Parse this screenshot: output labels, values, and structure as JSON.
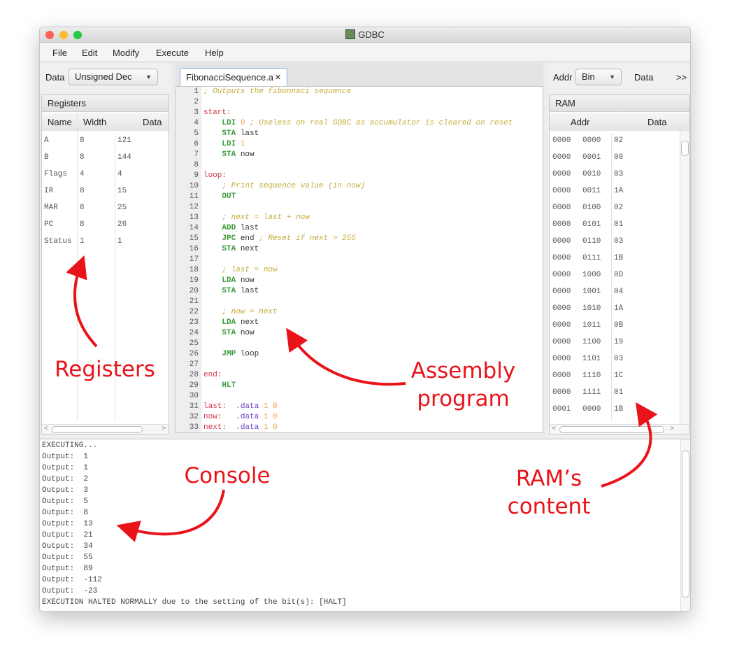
{
  "window": {
    "title": "GDBC",
    "controls": {
      "close": "#fc5f57",
      "minimize": "#fdbc2e",
      "maximize": "#28c840"
    }
  },
  "menu": [
    "File",
    "Edit",
    "Modify",
    "Execute",
    "Help"
  ],
  "left": {
    "data_label": "Data",
    "data_format": "Unsigned Dec",
    "panel_title": "Registers",
    "columns": [
      "Name",
      "Width",
      "Data"
    ],
    "rows": [
      [
        "A",
        "8",
        "121"
      ],
      [
        "B",
        "8",
        "144"
      ],
      [
        "Flags",
        "4",
        "4"
      ],
      [
        "IR",
        "8",
        "15"
      ],
      [
        "MAR",
        "8",
        "25"
      ],
      [
        "PC",
        "8",
        "26"
      ],
      [
        "Status",
        "1",
        "1"
      ]
    ]
  },
  "editor": {
    "tab_label": "FibonacciSequence.a",
    "close_icon": "×",
    "lines": [
      [
        [
          "c",
          "; Outputs the fibonnaci sequence"
        ]
      ],
      [],
      [
        [
          "l",
          "start:"
        ]
      ],
      [
        [
          "t",
          "    "
        ],
        [
          "k",
          "LDI"
        ],
        [
          "t",
          " "
        ],
        [
          "n",
          "0"
        ],
        [
          "c",
          " ; Useless on real GDBC as accumulator is cleared on reset"
        ]
      ],
      [
        [
          "t",
          "    "
        ],
        [
          "k",
          "STA"
        ],
        [
          "t",
          " last"
        ]
      ],
      [
        [
          "t",
          "    "
        ],
        [
          "k",
          "LDI"
        ],
        [
          "t",
          " "
        ],
        [
          "n",
          "1"
        ]
      ],
      [
        [
          "t",
          "    "
        ],
        [
          "k",
          "STA"
        ],
        [
          "t",
          " now"
        ]
      ],
      [],
      [
        [
          "l",
          "loop:"
        ]
      ],
      [
        [
          "t",
          "    "
        ],
        [
          "c",
          "; Print sequence value (in now)"
        ]
      ],
      [
        [
          "t",
          "    "
        ],
        [
          "k",
          "OUT"
        ]
      ],
      [],
      [
        [
          "t",
          "    "
        ],
        [
          "c",
          "; next = last + now"
        ]
      ],
      [
        [
          "t",
          "    "
        ],
        [
          "k",
          "ADD"
        ],
        [
          "t",
          " last"
        ]
      ],
      [
        [
          "t",
          "    "
        ],
        [
          "k",
          "JPC"
        ],
        [
          "t",
          " end "
        ],
        [
          "c",
          "; Reset if next > 255"
        ]
      ],
      [
        [
          "t",
          "    "
        ],
        [
          "k",
          "STA"
        ],
        [
          "t",
          " next"
        ]
      ],
      [],
      [
        [
          "t",
          "    "
        ],
        [
          "c",
          "; last = now"
        ]
      ],
      [
        [
          "t",
          "    "
        ],
        [
          "k",
          "LDA"
        ],
        [
          "t",
          " now"
        ]
      ],
      [
        [
          "t",
          "    "
        ],
        [
          "k",
          "STA"
        ],
        [
          "t",
          " last"
        ]
      ],
      [],
      [
        [
          "t",
          "    "
        ],
        [
          "c",
          "; now = next"
        ]
      ],
      [
        [
          "t",
          "    "
        ],
        [
          "k",
          "LDA"
        ],
        [
          "t",
          " next"
        ]
      ],
      [
        [
          "t",
          "    "
        ],
        [
          "k",
          "STA"
        ],
        [
          "t",
          " now"
        ]
      ],
      [],
      [
        [
          "t",
          "    "
        ],
        [
          "k",
          "JMP"
        ],
        [
          "t",
          " loop"
        ]
      ],
      [],
      [
        [
          "l",
          "end:"
        ]
      ],
      [
        [
          "t",
          "    "
        ],
        [
          "k",
          "HLT"
        ]
      ],
      [],
      [
        [
          "l",
          "last:"
        ],
        [
          "t",
          "  "
        ],
        [
          "d",
          ".data"
        ],
        [
          "t",
          " "
        ],
        [
          "n",
          "1 0"
        ]
      ],
      [
        [
          "l",
          "now:"
        ],
        [
          "t",
          "   "
        ],
        [
          "d",
          ".data"
        ],
        [
          "t",
          " "
        ],
        [
          "n",
          "1 0"
        ]
      ],
      [
        [
          "l",
          "next:"
        ],
        [
          "t",
          "  "
        ],
        [
          "d",
          ".data"
        ],
        [
          "t",
          " "
        ],
        [
          "n",
          "1 0"
        ]
      ]
    ]
  },
  "right": {
    "addr_label": "Addr",
    "addr_format": "Bin",
    "data_label": "Data",
    "more_label": ">>",
    "panel_title": "RAM",
    "columns": [
      "Addr",
      "Data"
    ],
    "rows": [
      [
        "0000",
        "0000",
        "02"
      ],
      [
        "0000",
        "0001",
        "00"
      ],
      [
        "0000",
        "0010",
        "03"
      ],
      [
        "0000",
        "0011",
        "1A"
      ],
      [
        "0000",
        "0100",
        "02"
      ],
      [
        "0000",
        "0101",
        "01"
      ],
      [
        "0000",
        "0110",
        "03"
      ],
      [
        "0000",
        "0111",
        "1B"
      ],
      [
        "0000",
        "1000",
        "0D"
      ],
      [
        "0000",
        "1001",
        "04"
      ],
      [
        "0000",
        "1010",
        "1A"
      ],
      [
        "0000",
        "1011",
        "0B"
      ],
      [
        "0000",
        "1100",
        "19"
      ],
      [
        "0000",
        "1101",
        "03"
      ],
      [
        "0000",
        "1110",
        "1C"
      ],
      [
        "0000",
        "1111",
        "01"
      ],
      [
        "0001",
        "0000",
        "1B"
      ]
    ]
  },
  "console": {
    "lines": [
      "EXECUTING...",
      "Output:  1",
      "Output:  1",
      "Output:  2",
      "Output:  3",
      "Output:  5",
      "Output:  8",
      "Output:  13",
      "Output:  21",
      "Output:  34",
      "Output:  55",
      "Output:  89",
      "Output:  -112",
      "Output:  -23",
      "EXECUTION HALTED NORMALLY due to the setting of the bit(s): [HALT]"
    ]
  },
  "annotations": {
    "registers": "Registers",
    "assembly": "Assembly\nprogram",
    "console": "Console",
    "ram": "RAM’s\ncontent",
    "color": "#e8141a"
  }
}
